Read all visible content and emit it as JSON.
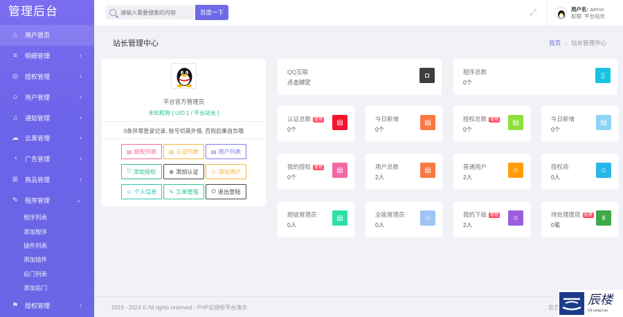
{
  "sidebar": {
    "brand": "管理后台",
    "items": [
      {
        "label": "用户首页",
        "icon": "home-icon",
        "glyph": "⌂",
        "active": true,
        "arrow": ""
      },
      {
        "label": "明细管理",
        "icon": "list-icon",
        "glyph": "≡",
        "active": false,
        "arrow": "›"
      },
      {
        "label": "授权管理",
        "icon": "shield-icon",
        "glyph": "◎",
        "active": false,
        "arrow": "›"
      },
      {
        "label": "用户管理",
        "icon": "user-icon",
        "glyph": "☺",
        "active": false,
        "arrow": "›"
      },
      {
        "label": "通知管理",
        "icon": "bell-icon",
        "glyph": "♫",
        "active": false,
        "arrow": "›"
      },
      {
        "label": "云黑管理",
        "icon": "cloud-icon",
        "glyph": "☁",
        "active": false,
        "arrow": "›"
      },
      {
        "label": "广告管理",
        "icon": "bullhorn-icon",
        "glyph": "◔",
        "active": false,
        "arrow": "›"
      },
      {
        "label": "商品管理",
        "icon": "cart-icon",
        "glyph": "⊞",
        "active": false,
        "arrow": "›"
      },
      {
        "label": "程序管理",
        "icon": "edit-icon",
        "glyph": "✎",
        "active": false,
        "arrow": "⌄"
      }
    ],
    "subitems": [
      "程序列表",
      "添加程序",
      "插件列表",
      "添加插件",
      "后门列表",
      "添加后门"
    ],
    "last_item": {
      "label": "授权管理",
      "icon": "flag-icon",
      "glyph": "⚑",
      "arrow": "›"
    }
  },
  "header": {
    "search_placeholder": "请输入需要搜索的内容",
    "search_button": "百度一下",
    "expand_glyph": "⤢",
    "user_name_label": "用户名:",
    "user_name": "admin",
    "user_role": "权限: 平台站长"
  },
  "page": {
    "title": "站长管理中心",
    "breadcrumb_home": "首页",
    "breadcrumb_sep": "›",
    "breadcrumb_current": "站长管理中心"
  },
  "profile": {
    "name": "平台官方管理员",
    "sub": "未知昵称 [ UID:1 / 平台站长 ]",
    "notice": "0条异常登录记录, 账号切莫外借, 否则后果自负哦",
    "buttons": [
      {
        "label": "授权列表",
        "glyph": "▤",
        "color": "#f06a8c",
        "name": "auth-list-button"
      },
      {
        "label": "认证列表",
        "glyph": "▤",
        "color": "#f3b43c",
        "name": "cert-list-button"
      },
      {
        "label": "用户列表",
        "glyph": "▤",
        "color": "#7f79ee",
        "name": "user-list-button"
      },
      {
        "label": "添加授权",
        "glyph": "⛉",
        "color": "#2ec28a",
        "name": "add-auth-button"
      },
      {
        "label": "添加认证",
        "glyph": "⊕",
        "color": "#444444",
        "name": "add-cert-button"
      },
      {
        "label": "添加用户",
        "glyph": "☺",
        "color": "#f3b43c",
        "name": "add-user-button"
      },
      {
        "label": "个人信息",
        "glyph": "☺",
        "color": "#2ec2b4",
        "name": "profile-info-button"
      },
      {
        "label": "工单管理",
        "glyph": "✎",
        "color": "#2ec28a",
        "name": "ticket-button"
      },
      {
        "label": "退出登陆",
        "glyph": "⏻",
        "color": "#444444",
        "name": "logout-button"
      }
    ]
  },
  "cards": [
    {
      "title": "QQ互联",
      "tag": "",
      "value": "点击绑定",
      "color": "#3e3e3e",
      "glyph": "◘",
      "icon": "qq-icon"
    },
    {
      "title": "程序总数",
      "tag": "",
      "value": "0个",
      "color": "#18c3e0",
      "glyph": "▯",
      "icon": "mobile-icon"
    },
    {
      "title": "认证总数",
      "tag": "管理",
      "value": "0个",
      "color": "#f5142e",
      "glyph": "▤",
      "icon": "file-icon"
    },
    {
      "title": "今日新增",
      "tag": "",
      "value": "0个",
      "color": "#f97946",
      "glyph": "▤",
      "icon": "file-icon"
    },
    {
      "title": "授权总数",
      "tag": "管理",
      "value": "0个",
      "color": "#8ee13c",
      "glyph": "▤",
      "icon": "file-icon"
    },
    {
      "title": "今日新增",
      "tag": "",
      "value": "0个",
      "color": "#8fd4f5",
      "glyph": "▤",
      "icon": "file-icon"
    },
    {
      "title": "我的授权",
      "tag": "管理",
      "value": "0个",
      "color": "#f268a4",
      "glyph": "▤",
      "icon": "file-icon"
    },
    {
      "title": "用户总数",
      "tag": "",
      "value": "2人",
      "color": "#f97946",
      "glyph": "▤",
      "icon": "file-icon"
    },
    {
      "title": "普通用户",
      "tag": "",
      "value": "2人",
      "color": "#ff9d0a",
      "glyph": "☺",
      "icon": "user-icon"
    },
    {
      "title": "授权商",
      "tag": "",
      "value": "0人",
      "color": "#29b6e8",
      "glyph": "☺",
      "icon": "user-icon"
    },
    {
      "title": "超级管理员",
      "tag": "",
      "value": "0人",
      "color": "#2ee0a8",
      "glyph": "▤",
      "icon": "file-icon"
    },
    {
      "title": "全能管理员",
      "tag": "",
      "value": "0人",
      "color": "#9ec4f5",
      "glyph": "☺",
      "icon": "user-icon"
    },
    {
      "title": "我的下级",
      "tag": "管理",
      "value": "2人",
      "color": "#9b5de0",
      "glyph": "☺",
      "icon": "user-icon"
    },
    {
      "title": "待处理提现",
      "tag": "处理",
      "value": "0笔",
      "color": "#3ea84a",
      "glyph": "¥",
      "icon": "yen-icon"
    }
  ],
  "footer": {
    "copyright": "2019 - 2024 © All rights reserved - PHP云授权平台演示",
    "right": "官方"
  },
  "watermark": {
    "big": "辰楼",
    "small": "Ch Leng Lou"
  }
}
